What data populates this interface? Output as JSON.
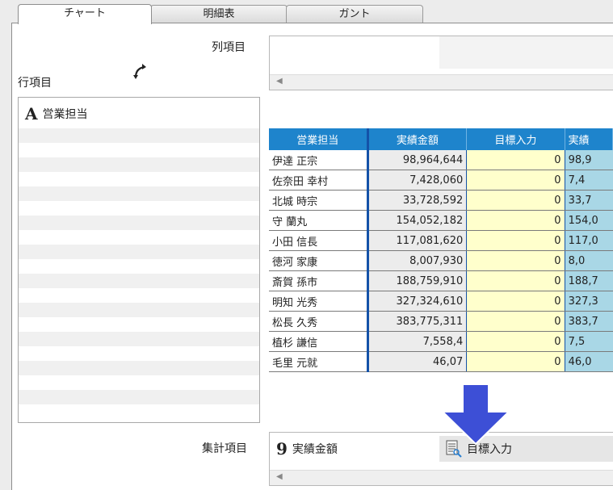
{
  "tabs": [
    {
      "label": "チャート",
      "active": true
    },
    {
      "label": "明細表",
      "active": false
    },
    {
      "label": "ガント",
      "active": false
    }
  ],
  "column_items_label": "列項目",
  "row_items_label": "行項目",
  "aggregate_items_label": "集計項目",
  "row_items": [
    {
      "icon": "text-field-icon",
      "glyph": "A",
      "label": "営業担当"
    }
  ],
  "aggregate_items": [
    {
      "icon": "number-field-icon",
      "glyph": "9",
      "label": "実績金額"
    },
    {
      "icon": "input-field-icon",
      "label": "目標入力"
    }
  ],
  "table": {
    "headers": [
      "営業担当",
      "実績金額",
      "目標入力",
      "実績"
    ],
    "rows": [
      {
        "name": "伊達 正宗",
        "actual": "98,964,644",
        "target": "0",
        "rate": "98,9"
      },
      {
        "name": "佐奈田 幸村",
        "actual": "7,428,060",
        "target": "0",
        "rate": "7,4"
      },
      {
        "name": "北城 時宗",
        "actual": "33,728,592",
        "target": "0",
        "rate": "33,7"
      },
      {
        "name": "守 蘭丸",
        "actual": "154,052,182",
        "target": "0",
        "rate": "154,0"
      },
      {
        "name": "小田 信長",
        "actual": "117,081,620",
        "target": "0",
        "rate": "117,0"
      },
      {
        "name": "徳河 家康",
        "actual": "8,007,930",
        "target": "0",
        "rate": "8,0"
      },
      {
        "name": "斎賀 孫市",
        "actual": "188,759,910",
        "target": "0",
        "rate": "188,7"
      },
      {
        "name": "明知 光秀",
        "actual": "327,324,610",
        "target": "0",
        "rate": "327,3"
      },
      {
        "name": "松長 久秀",
        "actual": "383,775,311",
        "target": "0",
        "rate": "383,7"
      },
      {
        "name": "植杉 謙信",
        "actual": "7,558,4",
        "target": "0",
        "rate": "7,5"
      },
      {
        "name": "毛里 元就",
        "actual": "46,07",
        "target": "0",
        "rate": "46,0"
      }
    ]
  },
  "colors": {
    "header_bg": "#1e84cc",
    "target_bg": "#ffffcc",
    "actual_bg": "#ececec",
    "rate_bg": "#a9d7e6",
    "annotation_arrow": "#3d4fd6"
  }
}
